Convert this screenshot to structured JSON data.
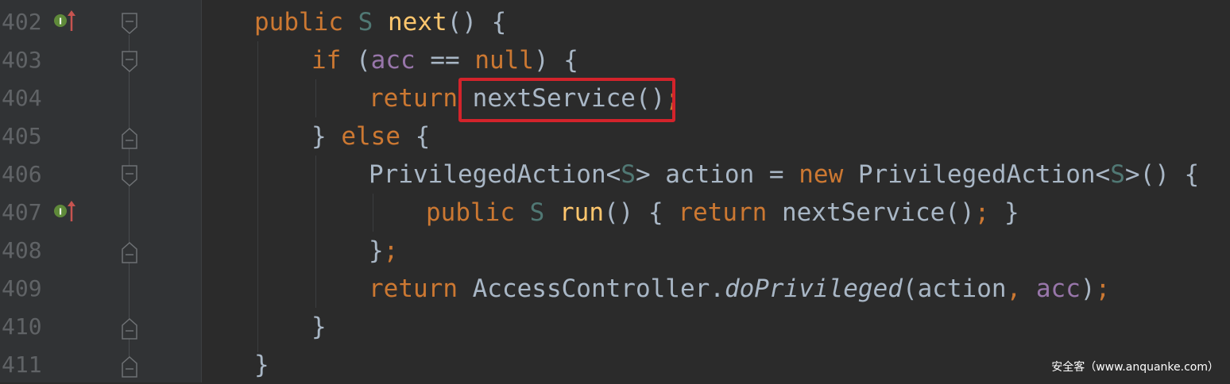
{
  "gutter": {
    "line_numbers": [
      "402",
      "403",
      "404",
      "405",
      "406",
      "407",
      "408",
      "409",
      "410",
      "411"
    ],
    "override_icon_text": "I"
  },
  "code": {
    "l402": {
      "indent": "    ",
      "t1": "public",
      "t2": " ",
      "t3": "S",
      "t4": " ",
      "t5": "next",
      "t6": "() {"
    },
    "l403": {
      "t1": "if",
      "t2": " (",
      "t3": "acc",
      "t4": " == ",
      "t5": "null",
      "t6": ") {"
    },
    "l404": {
      "t1": "return",
      "t2": " ",
      "t3": "nextService()",
      "t4": ";"
    },
    "l405": {
      "t1": "} ",
      "t2": "else",
      "t3": " {"
    },
    "l406": {
      "t1": "PrivilegedAction<",
      "t2": "S",
      "t3": "> action = ",
      "t4": "new",
      "t5": " PrivilegedAction<",
      "t6": "S",
      "t7": ">() {"
    },
    "l407": {
      "t1": "public",
      "t2": " ",
      "t3": "S",
      "t4": " ",
      "t5": "run",
      "t6": "() { ",
      "t7": "return",
      "t8": " nextService()",
      "t9": ";",
      "t10": " }"
    },
    "l408": {
      "t1": "}",
      "t2": ";"
    },
    "l409": {
      "t1": "return",
      "t2": " AccessController.",
      "t3": "doPrivileged",
      "t4": "(action",
      "t5": ", ",
      "t6": "acc",
      "t7": ")",
      "t8": ";"
    },
    "l410": {
      "t1": "}"
    },
    "l411": {
      "t1": "}"
    }
  },
  "watermark": "安全客（www.anquanke.com）",
  "colors": {
    "background": "#2b2b2b",
    "gutter": "#313335",
    "keyword": "#cc7832",
    "function": "#ffc66d",
    "type_param": "#507874",
    "field": "#9876aa",
    "plain": "#a9b7c6",
    "highlight_box": "#d3232b",
    "override_icon": "#5f8a3a",
    "override_arrow": "#c75450"
  }
}
